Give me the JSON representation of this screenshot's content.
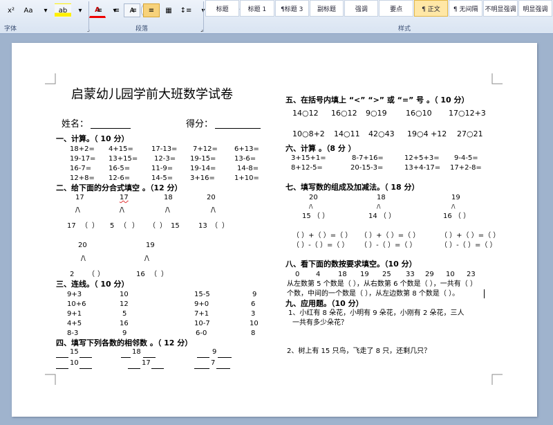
{
  "ribbon": {
    "font_group_label": "字体",
    "para_group_label": "段落",
    "styles_group_label": "样式",
    "font_buttons": [
      "x²",
      "Aa",
      "ab",
      "A",
      "A",
      "字"
    ],
    "styles": [
      "标题",
      "标题 1",
      "¶标题 3",
      "副标题",
      "强调",
      "要点",
      "¶ 正文",
      "¶ 无间隔",
      "不明显强调",
      "明显强调"
    ],
    "active_style_index": 6
  },
  "doc": {
    "title": "启蒙幼儿园学前大班数学试卷",
    "name_label": "姓名：",
    "score_label": "得分：",
    "s1": {
      "heading": "一、计算。（ 10 分）",
      "rows": [
        [
          "18+2=",
          "4+15=",
          "17-13=",
          "7+12=",
          "6+13="
        ],
        [
          "19-17=",
          "13+15=",
          "12-3=",
          "19-15=",
          "13-6="
        ],
        [
          "16-7=",
          "16-5=",
          "11-9=",
          "19-14=",
          "14-8="
        ],
        [
          "12+8=",
          "12-6=",
          "14-5=",
          "3+16=",
          "1+10="
        ]
      ]
    },
    "s2": {
      "heading": "二、给下面的分合式填空 。（12 分）",
      "tops": [
        "17",
        "17",
        "18",
        "20"
      ],
      "rows": [
        [
          "17",
          "（",
          "）"
        ],
        [
          "5",
          "（",
          "）"
        ],
        [
          "（",
          "）",
          "15"
        ],
        [
          "13",
          "（",
          "）"
        ]
      ],
      "tops2": [
        "20",
        "19"
      ],
      "rows2": [
        [
          "2",
          "（",
          "）"
        ],
        [
          "16",
          "（",
          "）"
        ]
      ],
      "mark": "/\\",
      "mark_small": "/\\"
    },
    "s3": {
      "heading": "三、连线。（ 10 分）",
      "left": [
        [
          "9+3",
          "10"
        ],
        [
          "10+6",
          "12"
        ],
        [
          "9+1",
          "5"
        ],
        [
          "4+5",
          "16"
        ],
        [
          "8-3",
          "9"
        ]
      ],
      "right": [
        [
          "15-5",
          "9"
        ],
        [
          "9+0",
          "6"
        ],
        [
          "7+1",
          "3"
        ],
        [
          "10-7",
          "10"
        ],
        [
          "6-0",
          "8"
        ]
      ]
    },
    "s4": {
      "heading": "四、填写下列各数的相邻数 。（ 12 分）",
      "rows": [
        [
          "15",
          "18",
          "9"
        ],
        [
          "10",
          "17",
          "7"
        ]
      ]
    },
    "s5": {
      "heading": "五、在括号内填上 “<” “>” 或 “=” 号 。（ 10 分）",
      "row1": [
        "14○12",
        "16○12",
        "9○19",
        "16○10",
        "17○12+3"
      ],
      "row2": [
        "10○8+2",
        "14○11",
        "42○43",
        "19○4 +12",
        "27○21"
      ]
    },
    "s6": {
      "heading": "六、计算 。（8 分 ）",
      "rows": [
        [
          "3+15+1=",
          "8-7+16=",
          "12+5+3=",
          "9-4-5="
        ],
        [
          "8+12-5=",
          "20-15-3=",
          "13+4-17=",
          "17+2-8="
        ]
      ]
    },
    "s7": {
      "heading": "七、填写数的组成及加减法。（ 18 分）",
      "tops": [
        "20",
        "18",
        "19"
      ],
      "mid": [
        "15 （ ）",
        "14 （ ）",
        "16 （ ）"
      ],
      "eq1": [
        "（ ）+（ ）=（ ）",
        "（ ）+（ ）=（ ）",
        "（ ）+（ ）=（ ）"
      ],
      "eq2": [
        "（ ）-（ ）=（ ）",
        "（ ）-（ ）=（ ）",
        "（ ）-（ ）=（ ）"
      ],
      "mark": "/\\"
    },
    "s8": {
      "heading": "八、看下面的数按要求填空。（10 分）",
      "numbers": [
        "0",
        "4",
        "18",
        "19",
        "25",
        "33",
        "29",
        "10",
        "23"
      ],
      "line1": "从左数第 5 个数是（ ），从右数第 6 个数是（ ），一共有（ ）",
      "line2": "个数，中间的一个数是（ ），从左边数第 8 个数是（ ）。"
    },
    "s9": {
      "heading": "九、应用题。（10 分）",
      "q1a": "1、小红有 8 朵花，小明有 9 朵花，小刚有 2 朵花，三人",
      "q1b": "一共有多少朵花？",
      "q2": "2、树上有 15 只鸟，飞走了 8 只，还剩几只？"
    }
  }
}
